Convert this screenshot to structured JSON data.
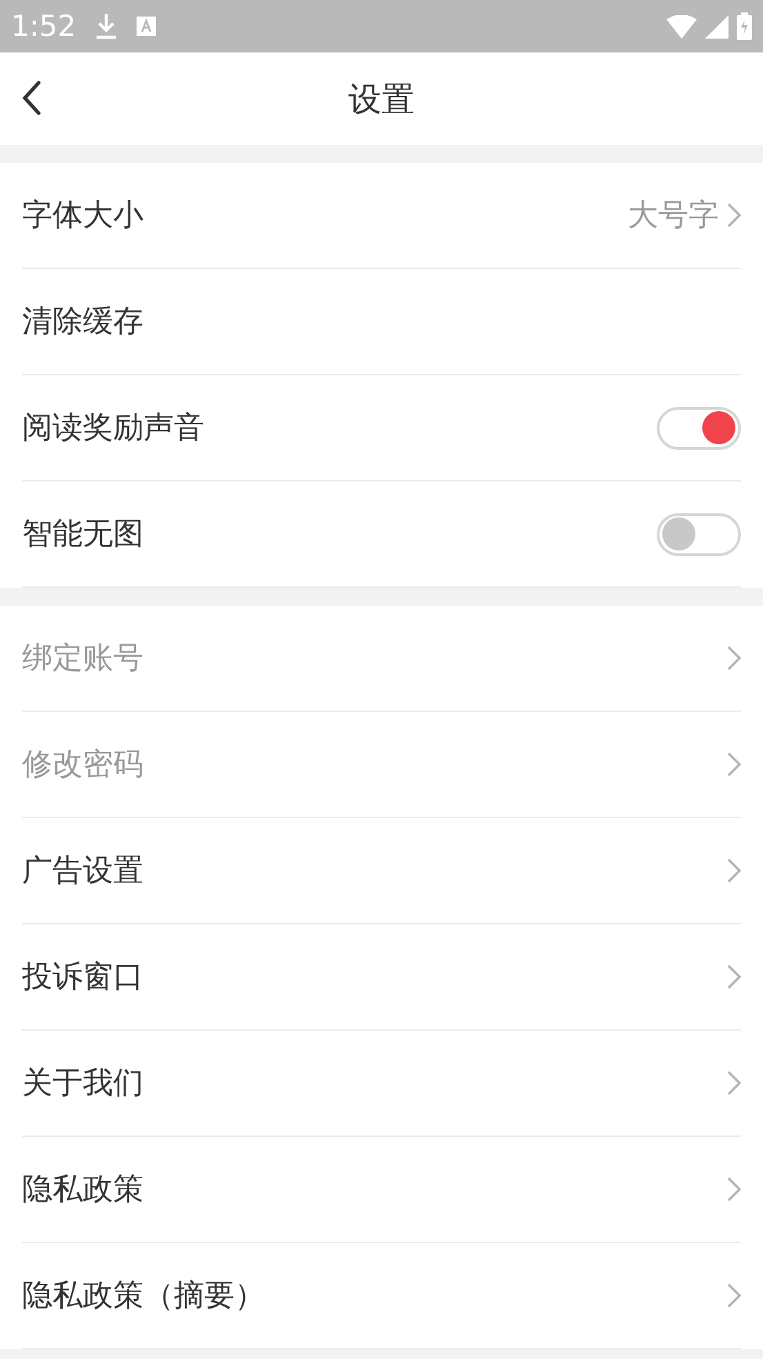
{
  "status_bar": {
    "time": "1:52"
  },
  "header": {
    "title": "设置"
  },
  "sections": [
    {
      "items": [
        {
          "kind": "link",
          "label": "字体大小",
          "value": "大号字",
          "disabled": false
        },
        {
          "kind": "plain",
          "label": "清除缓存",
          "disabled": false
        },
        {
          "kind": "toggle",
          "label": "阅读奖励声音",
          "on": true,
          "disabled": false
        },
        {
          "kind": "toggle",
          "label": "智能无图",
          "on": false,
          "disabled": false
        }
      ]
    },
    {
      "items": [
        {
          "kind": "link",
          "label": "绑定账号",
          "disabled": true
        },
        {
          "kind": "link",
          "label": "修改密码",
          "disabled": true
        },
        {
          "kind": "link",
          "label": "广告设置",
          "disabled": false
        },
        {
          "kind": "link",
          "label": "投诉窗口",
          "disabled": false
        },
        {
          "kind": "link",
          "label": "关于我们",
          "disabled": false
        },
        {
          "kind": "link",
          "label": "隐私政策",
          "disabled": false
        },
        {
          "kind": "link",
          "label": "隐私政策（摘要）",
          "disabled": false
        }
      ]
    }
  ]
}
